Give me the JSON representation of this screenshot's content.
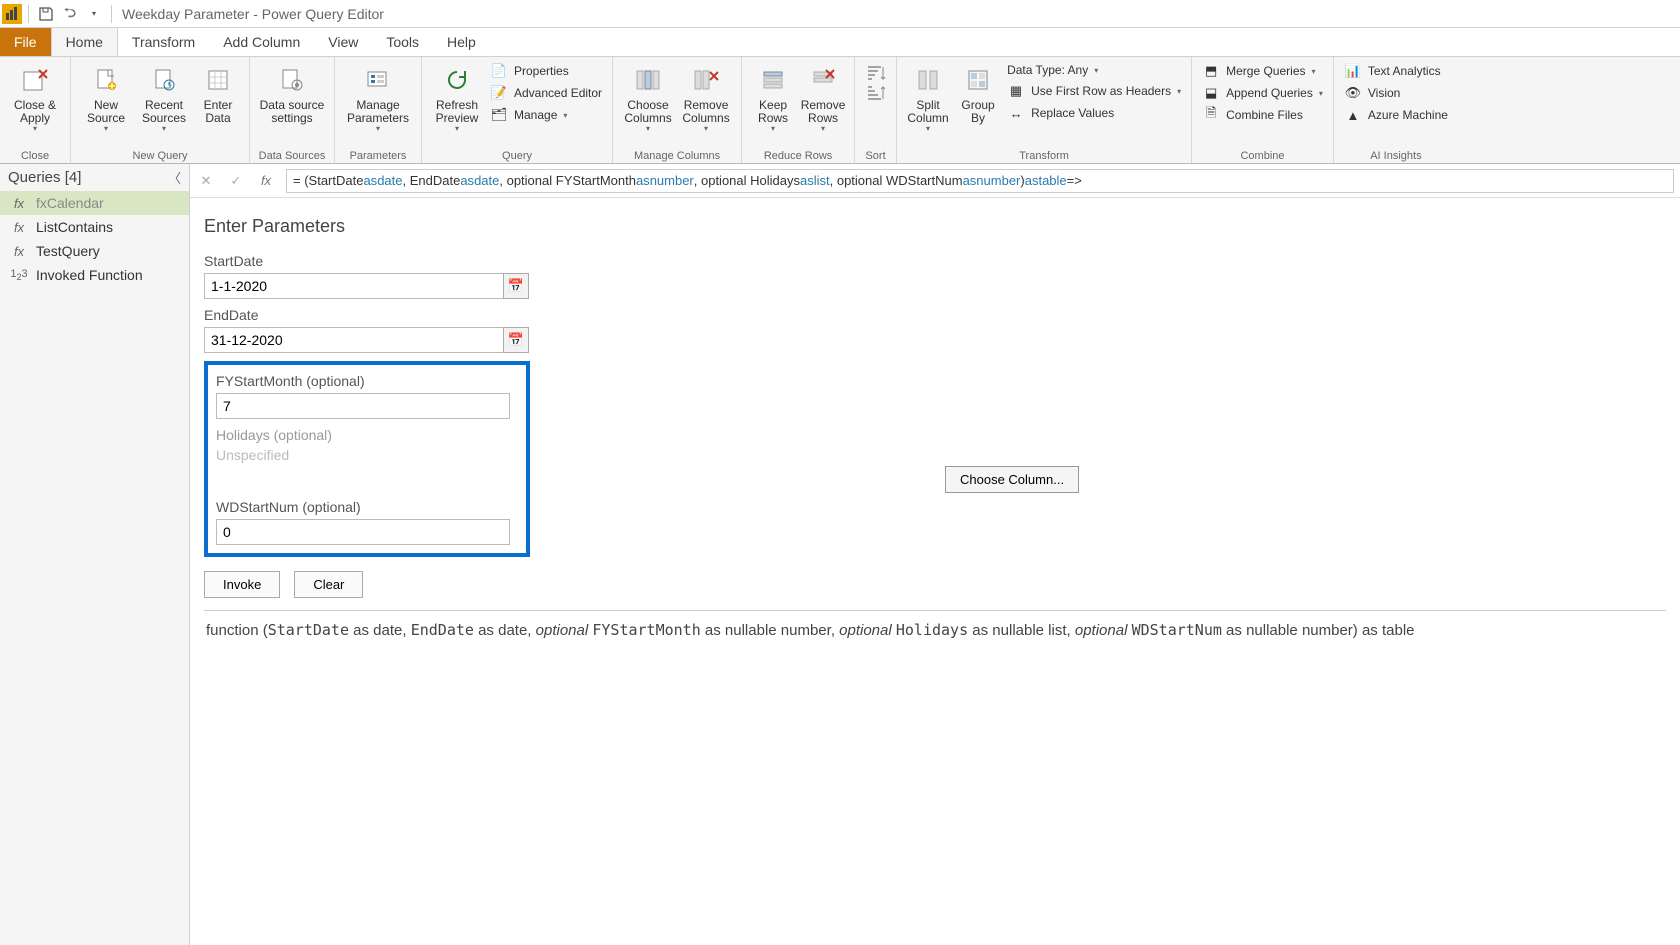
{
  "titlebar": {
    "title": "Weekday Parameter - Power Query Editor"
  },
  "tabs": {
    "file": "File",
    "home": "Home",
    "transform": "Transform",
    "addcol": "Add Column",
    "view": "View",
    "tools": "Tools",
    "help": "Help"
  },
  "ribbon": {
    "close": {
      "closeapply": "Close &\nApply",
      "group": "Close"
    },
    "newquery": {
      "newsource": "New\nSource",
      "recent": "Recent\nSources",
      "enter": "Enter\nData",
      "group": "New Query"
    },
    "datasources": {
      "settings": "Data source\nsettings",
      "group": "Data Sources"
    },
    "parameters": {
      "manage": "Manage\nParameters",
      "group": "Parameters"
    },
    "query": {
      "refresh": "Refresh\nPreview",
      "properties": "Properties",
      "adveditor": "Advanced Editor",
      "manage": "Manage",
      "group": "Query"
    },
    "managecols": {
      "choose": "Choose\nColumns",
      "remove": "Remove\nColumns",
      "group": "Manage Columns"
    },
    "reducerows": {
      "keep": "Keep\nRows",
      "remove": "Remove\nRows",
      "group": "Reduce Rows"
    },
    "sort": {
      "group": "Sort"
    },
    "transform": {
      "split": "Split\nColumn",
      "groupby": "Group\nBy",
      "datatype": "Data Type: Any",
      "firstrow": "Use First Row as Headers",
      "replace": "Replace Values",
      "group": "Transform"
    },
    "combine": {
      "merge": "Merge Queries",
      "append": "Append Queries",
      "combinefiles": "Combine Files",
      "group": "Combine"
    },
    "ai": {
      "text": "Text Analytics",
      "vision": "Vision",
      "azure": "Azure Machine",
      "group": "AI Insights"
    }
  },
  "queries": {
    "header": "Queries [4]",
    "items": [
      {
        "icon": "fx",
        "label": "fxCalendar",
        "sel": true,
        "dim": true
      },
      {
        "icon": "fx",
        "label": "ListContains",
        "sel": false,
        "dim": false
      },
      {
        "icon": "fx",
        "label": "TestQuery",
        "sel": false,
        "dim": false
      },
      {
        "icon": "1₂3",
        "label": "Invoked Function",
        "sel": false,
        "dim": false
      }
    ]
  },
  "formula": {
    "prefix": "= (StartDate ",
    "as1": "as ",
    "date1": "date",
    "mid1": ", EndDate ",
    "as2": "as ",
    "date2": "date",
    "mid2": ", optional FYStartMonth ",
    "as3": "as ",
    "number1": "number",
    "mid3": ", optional Holidays ",
    "as4": "as ",
    "list1": "list",
    "mid4": ", optional WDStartNum ",
    "as5": "as ",
    "number2": "number",
    "mid5": ") ",
    "as6": "as ",
    "table1": "table",
    "tail": " =>"
  },
  "params": {
    "title": "Enter Parameters",
    "startdate_lbl": "StartDate",
    "startdate_val": "1-1-2020",
    "enddate_lbl": "EndDate",
    "enddate_val": "31-12-2020",
    "fystart_lbl": "FYStartMonth (optional)",
    "fystart_val": "7",
    "holidays_lbl": "Holidays (optional)",
    "holidays_placeholder": "Unspecified",
    "wdstart_lbl": "WDStartNum (optional)",
    "wdstart_val": "0",
    "invoke": "Invoke",
    "clear": "Clear",
    "choosecol": "Choose Column..."
  },
  "signature": {
    "p1": "function (",
    "p2": "StartDate",
    "p3": " as date, ",
    "p4": "EndDate",
    "p5": " as date, ",
    "p6": "optional ",
    "p7": "FYStartMonth",
    "p8": " as nullable number, ",
    "p9": "optional ",
    "p10": "Holidays",
    "p11": " as nullable list, ",
    "p12": "optional ",
    "p13": "WDStartNum",
    "p14": " as nullable number) as table"
  }
}
